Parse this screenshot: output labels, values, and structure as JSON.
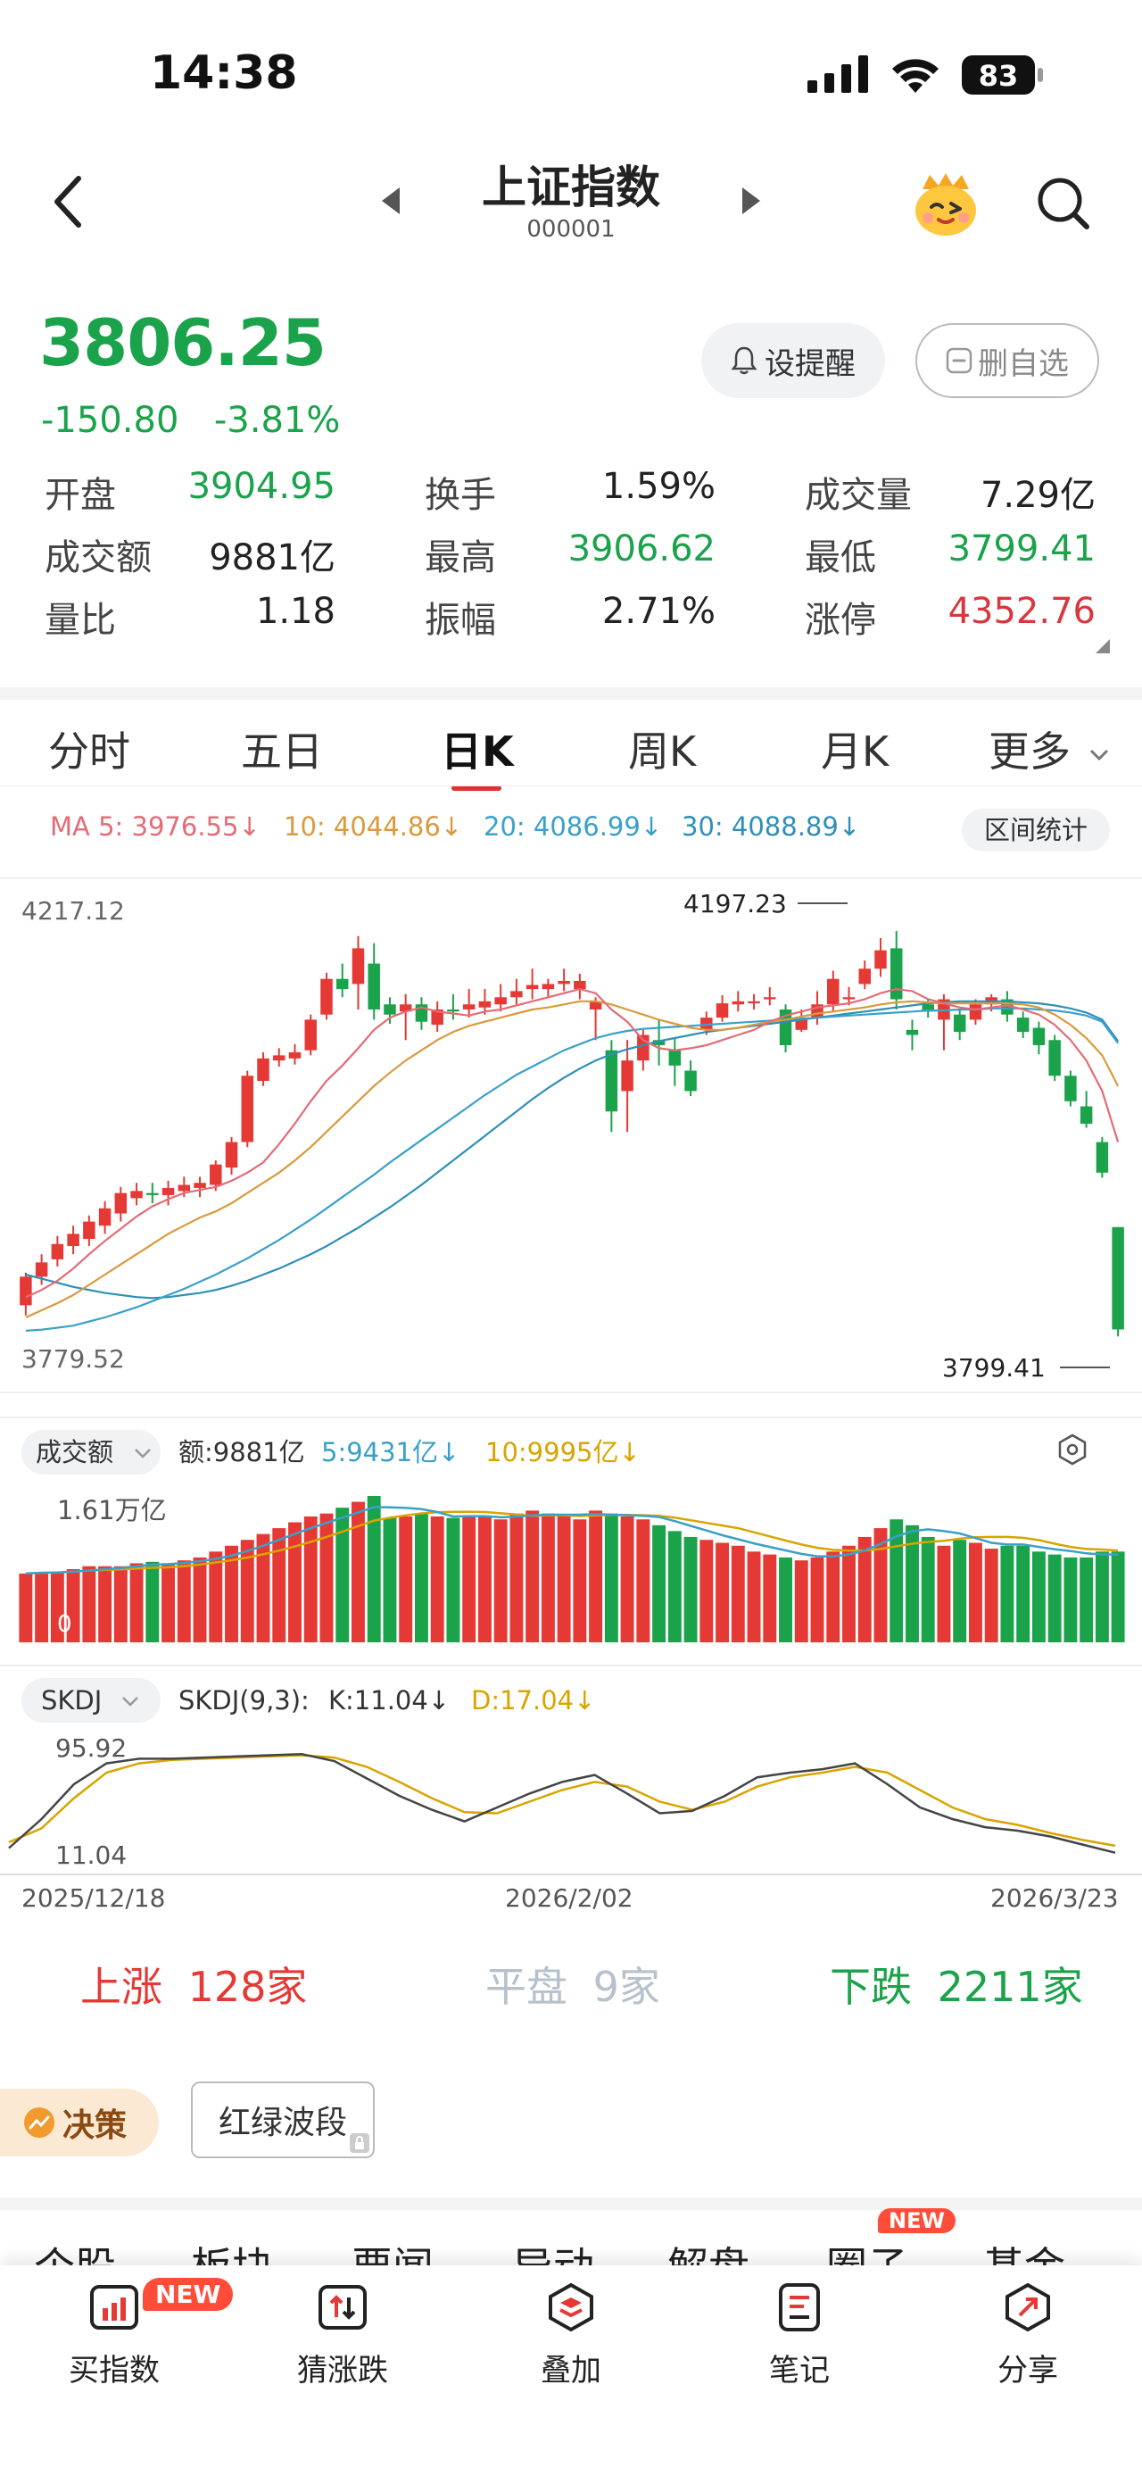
{
  "status_bar": {
    "time": "14:38",
    "battery": "83"
  },
  "nav": {
    "title": "上证指数",
    "code": "000001"
  },
  "quote": {
    "price": "3806.25",
    "change": "-150.80",
    "change_pct": "-3.81%",
    "alert_label": "设提醒",
    "remove_watch_label": "删自选",
    "stats": [
      {
        "label": "开盘",
        "value": "3904.95",
        "color": "#1aa34a"
      },
      {
        "label": "换手",
        "value": "1.59%",
        "color": "#222222"
      },
      {
        "label": "成交量",
        "value": "7.29亿",
        "color": "#222222"
      },
      {
        "label": "成交额",
        "value": "9881亿",
        "color": "#222222"
      },
      {
        "label": "最高",
        "value": "3906.62",
        "color": "#1aa34a"
      },
      {
        "label": "最低",
        "value": "3799.41",
        "color": "#1aa34a"
      },
      {
        "label": "量比",
        "value": "1.18",
        "color": "#222222"
      },
      {
        "label": "振幅",
        "value": "2.71%",
        "color": "#222222"
      },
      {
        "label": "涨停",
        "value": "4352.76",
        "color": "#d9363e"
      }
    ]
  },
  "tabs": [
    "分时",
    "五日",
    "日K",
    "周K",
    "月K",
    "更多"
  ],
  "active_tab": "日K",
  "ma": {
    "ma5": "MA 5: 3976.55↓",
    "ma10": "10: 4044.86↓",
    "ma20": "20: 4086.99↓",
    "ma30": "30: 4088.89↓",
    "stats_button": "区间统计"
  },
  "kline": {
    "axis_top": "4217.12",
    "axis_bottom": "3779.52",
    "high_mark": "4197.23",
    "low_mark": "3799.41"
  },
  "volume": {
    "selector": "成交额",
    "amount": "额:9881亿",
    "ma5": "5:9431亿↓",
    "ma10": "10:9995亿↓",
    "axis_top": "1.61万亿",
    "axis_zero": "0"
  },
  "skdj": {
    "selector": "SKDJ",
    "params": "SKDJ(9,3):",
    "k": "K:11.04↓",
    "d": "D:17.04↓",
    "axis_top": "95.92",
    "axis_bottom": "11.04"
  },
  "dates": {
    "start": "2025/12/18",
    "mid": "2026/2/02",
    "end": "2026/3/23"
  },
  "breadth": {
    "up": "上涨",
    "up_count": "128家",
    "flat": "平盘",
    "flat_count": "9家",
    "down": "下跌",
    "down_count": "2211家"
  },
  "decision": {
    "label": "决策",
    "button": "红绿波段"
  },
  "subtabs": {
    "items": [
      "个股",
      "板块",
      "要闻",
      "异动",
      "解盘",
      "圈子",
      "基金"
    ],
    "new_badge": "NEW"
  },
  "bottom_bar": [
    {
      "label": "买指数",
      "badge": "NEW"
    },
    {
      "label": "猜涨跌"
    },
    {
      "label": "叠加"
    },
    {
      "label": "笔记"
    },
    {
      "label": "分享"
    }
  ],
  "colors": {
    "up": "#e53935",
    "down": "#1aa34a",
    "ma5": "#e46b76",
    "ma10": "#d99a3d",
    "ma20": "#3aa0c8",
    "ma30": "#2f8fb8"
  },
  "chart_data": {
    "type": "candlestick",
    "price_range": [
      3779.52,
      4217.12
    ],
    "candles": [
      [
        3830,
        3858,
        3820,
        3862
      ],
      [
        3858,
        3872,
        3850,
        3880
      ],
      [
        3875,
        3890,
        3868,
        3898
      ],
      [
        3888,
        3900,
        3880,
        3908
      ],
      [
        3895,
        3912,
        3888,
        3918
      ],
      [
        3908,
        3925,
        3900,
        3932
      ],
      [
        3920,
        3940,
        3912,
        3946
      ],
      [
        3935,
        3942,
        3928,
        3950
      ],
      [
        3940,
        3938,
        3930,
        3950
      ],
      [
        3938,
        3945,
        3928,
        3952
      ],
      [
        3942,
        3948,
        3936,
        3956
      ],
      [
        3945,
        3950,
        3936,
        3956
      ],
      [
        3948,
        3968,
        3942,
        3972
      ],
      [
        3965,
        3990,
        3958,
        3995
      ],
      [
        3990,
        4055,
        3985,
        4060
      ],
      [
        4050,
        4072,
        4045,
        4078
      ],
      [
        4070,
        4075,
        4064,
        4082
      ],
      [
        4072,
        4078,
        4066,
        4086
      ],
      [
        4080,
        4110,
        4075,
        4115
      ],
      [
        4115,
        4150,
        4110,
        4156
      ],
      [
        4150,
        4140,
        4132,
        4165
      ],
      [
        4145,
        4180,
        4120,
        4192
      ],
      [
        4165,
        4120,
        4110,
        4185
      ],
      [
        4125,
        4115,
        4106,
        4132
      ],
      [
        4118,
        4125,
        4090,
        4135
      ],
      [
        4125,
        4108,
        4100,
        4132
      ],
      [
        4105,
        4120,
        4098,
        4128
      ],
      [
        4120,
        4118,
        4110,
        4135
      ],
      [
        4120,
        4125,
        4112,
        4140
      ],
      [
        4122,
        4128,
        4115,
        4140
      ],
      [
        4125,
        4132,
        4118,
        4145
      ],
      [
        4132,
        4138,
        4125,
        4150
      ],
      [
        4140,
        4144,
        4130,
        4160
      ],
      [
        4140,
        4145,
        4132,
        4150
      ],
      [
        4145,
        4148,
        4138,
        4160
      ],
      [
        4140,
        4148,
        4130,
        4155
      ],
      [
        4120,
        4128,
        4090,
        4132
      ],
      [
        4080,
        4020,
        4000,
        4090
      ],
      [
        4040,
        4070,
        4000,
        4090
      ],
      [
        4070,
        4095,
        4060,
        4100
      ],
      [
        4090,
        4085,
        4065,
        4110
      ],
      [
        4080,
        4065,
        4045,
        4092
      ],
      [
        4060,
        4040,
        4035,
        4070
      ],
      [
        4100,
        4112,
        4095,
        4118
      ],
      [
        4112,
        4126,
        4108,
        4134
      ],
      [
        4125,
        4128,
        4118,
        4138
      ],
      [
        4126,
        4128,
        4120,
        4135
      ],
      [
        4130,
        4132,
        4124,
        4142
      ],
      [
        4120,
        4085,
        4078,
        4125
      ],
      [
        4100,
        4112,
        4098,
        4120
      ],
      [
        4112,
        4125,
        4105,
        4138
      ],
      [
        4125,
        4150,
        4118,
        4158
      ],
      [
        4130,
        4132,
        4124,
        4142
      ],
      [
        4145,
        4160,
        4140,
        4168
      ],
      [
        4160,
        4178,
        4152,
        4190
      ],
      [
        4180,
        4130,
        4120,
        4197
      ],
      [
        4100,
        4095,
        4080,
        4110
      ],
      [
        4125,
        4118,
        4112,
        4130
      ],
      [
        4110,
        4130,
        4080,
        4135
      ],
      [
        4115,
        4098,
        4090,
        4120
      ],
      [
        4110,
        4125,
        4105,
        4130
      ],
      [
        4125,
        4132,
        4118,
        4135
      ],
      [
        4130,
        4115,
        4108,
        4138
      ],
      [
        4112,
        4098,
        4092,
        4118
      ],
      [
        4102,
        4085,
        4076,
        4108
      ],
      [
        4090,
        4055,
        4050,
        4095
      ],
      [
        4055,
        4030,
        4025,
        4060
      ],
      [
        4025,
        4008,
        4004,
        4040
      ],
      [
        3990,
        3960,
        3955,
        3995
      ],
      [
        3906.62,
        3806.25,
        3799.41,
        3906.62
      ]
    ],
    "ma5": [
      3838,
      3845,
      3854,
      3866,
      3880,
      3893,
      3905,
      3917,
      3927,
      3934,
      3940,
      3943,
      3946,
      3952,
      3960,
      3970,
      3988,
      4008,
      4030,
      4050,
      4065,
      4082,
      4100,
      4112,
      4118,
      4122,
      4118,
      4116,
      4114,
      4118,
      4120,
      4124,
      4128,
      4132,
      4136,
      4140,
      4136,
      4120,
      4108,
      4090,
      4082,
      4080,
      4082,
      4085,
      4090,
      4095,
      4100,
      4108,
      4114,
      4118,
      4122,
      4124,
      4126,
      4130,
      4136,
      4140,
      4138,
      4130,
      4126,
      4122,
      4120,
      4122,
      4124,
      4120,
      4115,
      4105,
      4090,
      4070,
      4040,
      3990
    ],
    "ma10": [
      3818,
      3825,
      3832,
      3840,
      3850,
      3860,
      3870,
      3880,
      3890,
      3900,
      3908,
      3916,
      3922,
      3930,
      3940,
      3950,
      3960,
      3972,
      3985,
      4000,
      4015,
      4030,
      4045,
      4058,
      4070,
      4080,
      4090,
      4098,
      4104,
      4108,
      4112,
      4116,
      4120,
      4122,
      4125,
      4128,
      4128,
      4125,
      4120,
      4115,
      4110,
      4106,
      4102,
      4100,
      4100,
      4102,
      4105,
      4108,
      4110,
      4113,
      4116,
      4118,
      4120,
      4122,
      4125,
      4127,
      4128,
      4127,
      4126,
      4126,
      4126,
      4126,
      4126,
      4125,
      4122,
      4115,
      4105,
      4092,
      4075,
      4045
    ],
    "ma20": [
      3805,
      3806,
      3808,
      3810,
      3814,
      3818,
      3823,
      3828,
      3834,
      3840,
      3846,
      3853,
      3860,
      3868,
      3876,
      3885,
      3894,
      3904,
      3914,
      3925,
      3936,
      3947,
      3958,
      3970,
      3981,
      3992,
      4003,
      4014,
      4025,
      4036,
      4046,
      4056,
      4064,
      4072,
      4080,
      4086,
      4092,
      4096,
      4099,
      4101,
      4102,
      4103,
      4104,
      4105,
      4106,
      4107,
      4108,
      4109,
      4110,
      4111,
      4112,
      4113,
      4114,
      4115,
      4116,
      4117,
      4118,
      4119,
      4119,
      4120,
      4120,
      4121,
      4121,
      4121,
      4120,
      4119,
      4117,
      4114,
      4108,
      4087
    ],
    "ma30": [
      3860,
      3856,
      3852,
      3848,
      3845,
      3842,
      3840,
      3838,
      3837,
      3838,
      3840,
      3842,
      3845,
      3849,
      3854,
      3860,
      3866,
      3873,
      3880,
      3888,
      3897,
      3906,
      3916,
      3926,
      3937,
      3948,
      3960,
      3972,
      3984,
      3996,
      4008,
      4020,
      4032,
      4043,
      4053,
      4062,
      4070,
      4076,
      4081,
      4085,
      4089,
      4092,
      4095,
      4098,
      4100,
      4102,
      4104,
      4106,
      4108,
      4110,
      4112,
      4114,
      4116,
      4118,
      4120,
      4122,
      4124,
      4126,
      4127,
      4128,
      4128,
      4128,
      4128,
      4127,
      4126,
      4124,
      4121,
      4117,
      4110,
      4089
    ],
    "volume_ratio": [
      0.47,
      0.48,
      0.48,
      0.5,
      0.52,
      0.52,
      0.52,
      0.54,
      0.55,
      0.54,
      0.56,
      0.58,
      0.62,
      0.66,
      0.7,
      0.74,
      0.78,
      0.82,
      0.86,
      0.88,
      0.92,
      0.96,
      1.0,
      0.85,
      0.86,
      0.88,
      0.86,
      0.85,
      0.86,
      0.86,
      0.84,
      0.88,
      0.9,
      0.88,
      0.86,
      0.84,
      0.9,
      0.88,
      0.86,
      0.84,
      0.8,
      0.76,
      0.72,
      0.7,
      0.68,
      0.66,
      0.62,
      0.6,
      0.58,
      0.56,
      0.58,
      0.62,
      0.66,
      0.72,
      0.78,
      0.84,
      0.8,
      0.72,
      0.66,
      0.7,
      0.68,
      0.64,
      0.66,
      0.66,
      0.62,
      0.6,
      0.58,
      0.58,
      0.62,
      0.62
    ],
    "skdj_k": [
      15,
      40,
      70,
      88,
      92,
      92,
      93,
      94,
      95,
      96,
      90,
      75,
      60,
      48,
      38,
      50,
      62,
      72,
      78,
      62,
      45,
      47,
      60,
      76,
      80,
      83,
      88,
      70,
      50,
      40,
      33,
      30,
      25,
      18,
      11
    ],
    "skdj_d": [
      20,
      32,
      58,
      80,
      88,
      91,
      92,
      93,
      94,
      95,
      93,
      85,
      72,
      58,
      46,
      45,
      55,
      65,
      72,
      68,
      55,
      48,
      55,
      68,
      76,
      80,
      85,
      80,
      65,
      50,
      40,
      35,
      28,
      22,
      17
    ]
  }
}
